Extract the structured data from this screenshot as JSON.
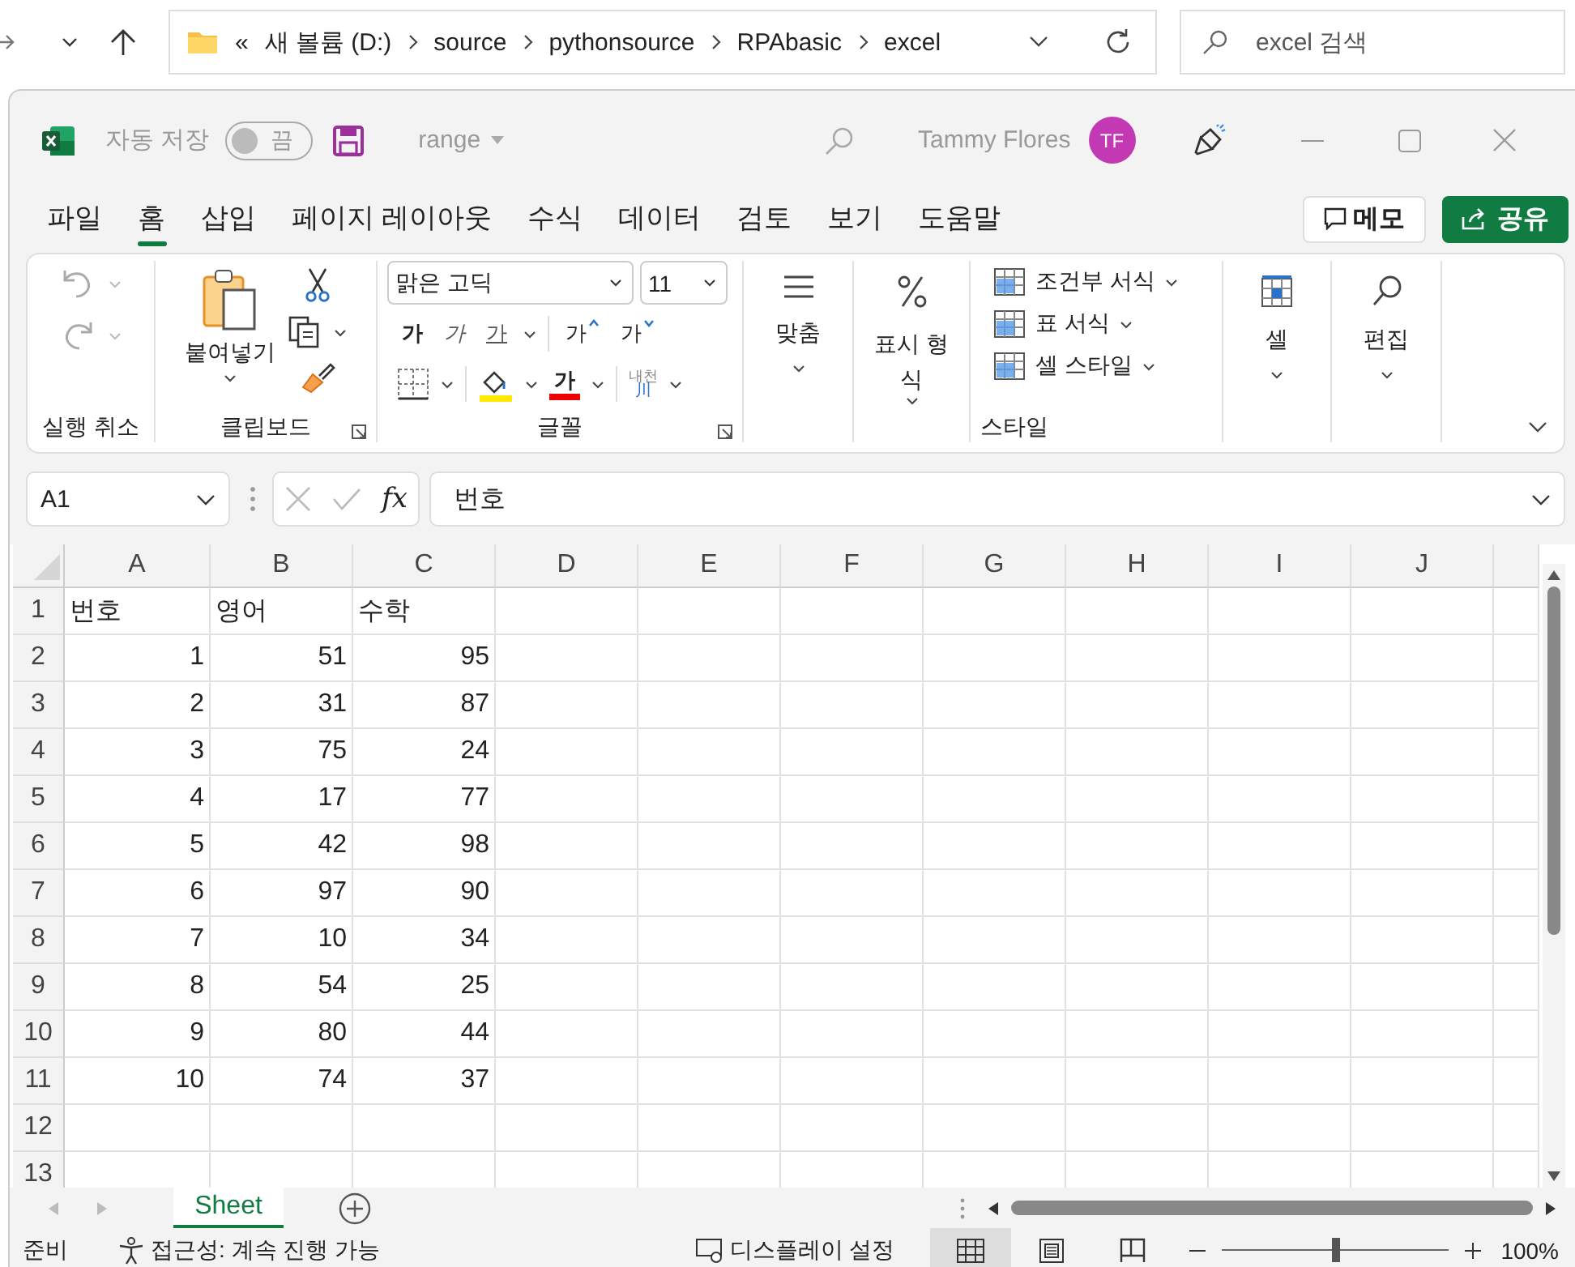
{
  "explorer": {
    "path_overflow": "«",
    "path": [
      "새 볼륨 (D:)",
      "source",
      "pythonsource",
      "RPAbasic",
      "excel"
    ],
    "search_placeholder": "excel 검색"
  },
  "title_bar": {
    "autosave_label": "자동 저장",
    "autosave_on": false,
    "autosave_state": "끔",
    "file_name": "range",
    "user_name": "Tammy Flores",
    "user_initials": "TF"
  },
  "menu_tabs": [
    {
      "label": "파일",
      "selected": false
    },
    {
      "label": "홈",
      "selected": true
    },
    {
      "label": "삽입",
      "selected": false
    },
    {
      "label": "페이지 레이아웃",
      "selected": false
    },
    {
      "label": "수식",
      "selected": false
    },
    {
      "label": "데이터",
      "selected": false
    },
    {
      "label": "검토",
      "selected": false
    },
    {
      "label": "보기",
      "selected": false
    },
    {
      "label": "도움말",
      "selected": false
    }
  ],
  "memo_button": "메모",
  "share_button": "공유",
  "ribbon": {
    "undo_group": "실행 취소",
    "clipboard": {
      "paste": "붙여넣기",
      "label": "클립보드"
    },
    "font": {
      "name": "맑은 고딕",
      "size": "11",
      "bold": "가",
      "italic": "가",
      "underline": "가",
      "grow": "가",
      "shrink": "가",
      "font_color": "가",
      "phonetic_top": "내천",
      "phonetic_bottom": "川",
      "label": "글꼴"
    },
    "alignment": "맞춤",
    "number_format": "표시 형식",
    "styles": {
      "items": [
        "조건부 서식",
        "표 서식",
        "셀 스타일"
      ],
      "label": "스타일"
    },
    "cells": "셀",
    "editing": "편집"
  },
  "formula_bar": {
    "name_box": "A1",
    "fx": "fx",
    "content": "번호"
  },
  "grid": {
    "columns": [
      "A",
      "B",
      "C",
      "D",
      "E",
      "F",
      "G",
      "H",
      "I",
      "J"
    ],
    "rows": [
      {
        "number": "1",
        "kind": "text",
        "cells": [
          "번호",
          "영어",
          "수학"
        ]
      },
      {
        "number": "2",
        "kind": "number",
        "cells": [
          "1",
          "51",
          "95"
        ]
      },
      {
        "number": "3",
        "kind": "number",
        "cells": [
          "2",
          "31",
          "87"
        ]
      },
      {
        "number": "4",
        "kind": "number",
        "cells": [
          "3",
          "75",
          "24"
        ]
      },
      {
        "number": "5",
        "kind": "number",
        "cells": [
          "4",
          "17",
          "77"
        ]
      },
      {
        "number": "6",
        "kind": "number",
        "cells": [
          "5",
          "42",
          "98"
        ]
      },
      {
        "number": "7",
        "kind": "number",
        "cells": [
          "6",
          "97",
          "90"
        ]
      },
      {
        "number": "8",
        "kind": "number",
        "cells": [
          "7",
          "10",
          "34"
        ]
      },
      {
        "number": "9",
        "kind": "number",
        "cells": [
          "8",
          "54",
          "25"
        ]
      },
      {
        "number": "10",
        "kind": "number",
        "cells": [
          "9",
          "80",
          "44"
        ]
      },
      {
        "number": "11",
        "kind": "number",
        "cells": [
          "10",
          "74",
          "37"
        ]
      },
      {
        "number": "12"
      },
      {
        "number": "13"
      }
    ]
  },
  "sheet_tabs": [
    {
      "label": "Sheet",
      "selected": true
    }
  ],
  "status_bar": {
    "mode": "준비",
    "accessibility": "접근성: 계속 진행 가능",
    "display_settings": "디스플레이 설정",
    "views": [
      {
        "kind": "normal",
        "selected": true
      },
      {
        "kind": "page_layout",
        "selected": false
      },
      {
        "kind": "page_break",
        "selected": false
      }
    ],
    "zoom": {
      "level": 0.5,
      "reading": "100%"
    }
  }
}
